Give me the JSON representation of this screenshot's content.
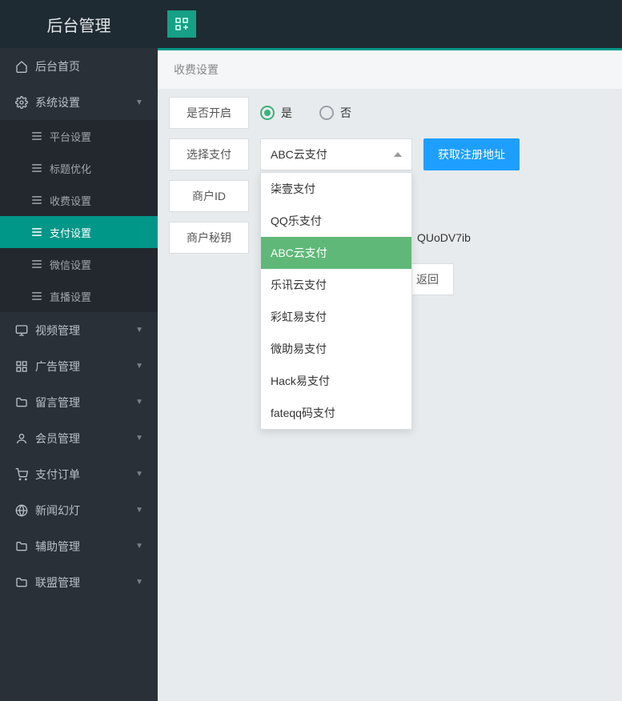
{
  "brand": "后台管理",
  "breadcrumb": "收费设置",
  "sidebar": {
    "items": [
      {
        "icon": "home",
        "label": "后台首页",
        "expandable": false
      },
      {
        "icon": "gear",
        "label": "系统设置",
        "expandable": true,
        "expanded": true,
        "children": [
          {
            "label": "平台设置"
          },
          {
            "label": "标题优化"
          },
          {
            "label": "收费设置"
          },
          {
            "label": "支付设置",
            "active": true
          },
          {
            "label": "微信设置"
          },
          {
            "label": "直播设置"
          }
        ]
      },
      {
        "icon": "monitor",
        "label": "视频管理",
        "expandable": true
      },
      {
        "icon": "grid",
        "label": "广告管理",
        "expandable": true
      },
      {
        "icon": "folder",
        "label": "留言管理",
        "expandable": true
      },
      {
        "icon": "user",
        "label": "会员管理",
        "expandable": true
      },
      {
        "icon": "cart",
        "label": "支付订单",
        "expandable": true
      },
      {
        "icon": "globe",
        "label": "新闻幻灯",
        "expandable": true
      },
      {
        "icon": "folder",
        "label": "辅助管理",
        "expandable": true
      },
      {
        "icon": "folder",
        "label": "联盟管理",
        "expandable": true
      }
    ]
  },
  "form": {
    "enable_label": "是否开启",
    "enable_yes": "是",
    "enable_no": "否",
    "enable_value": "yes",
    "payment_label": "选择支付",
    "payment_selected": "ABC云支付",
    "payment_options": [
      {
        "label": "柒壹支付"
      },
      {
        "label": "QQ乐支付"
      },
      {
        "label": "ABC云支付",
        "selected": true
      },
      {
        "label": "乐讯云支付"
      },
      {
        "label": "彩虹易支付"
      },
      {
        "label": "微助易支付"
      },
      {
        "label": "Hack易支付"
      },
      {
        "label": "fateqq码支付"
      }
    ],
    "register_button": "获取注册地址",
    "merchant_id_label": "商户ID",
    "merchant_id_value": "",
    "merchant_key_label": "商户秘钥",
    "merchant_key_value_suffix": "QUoDV7ib",
    "back_button": "返回"
  }
}
